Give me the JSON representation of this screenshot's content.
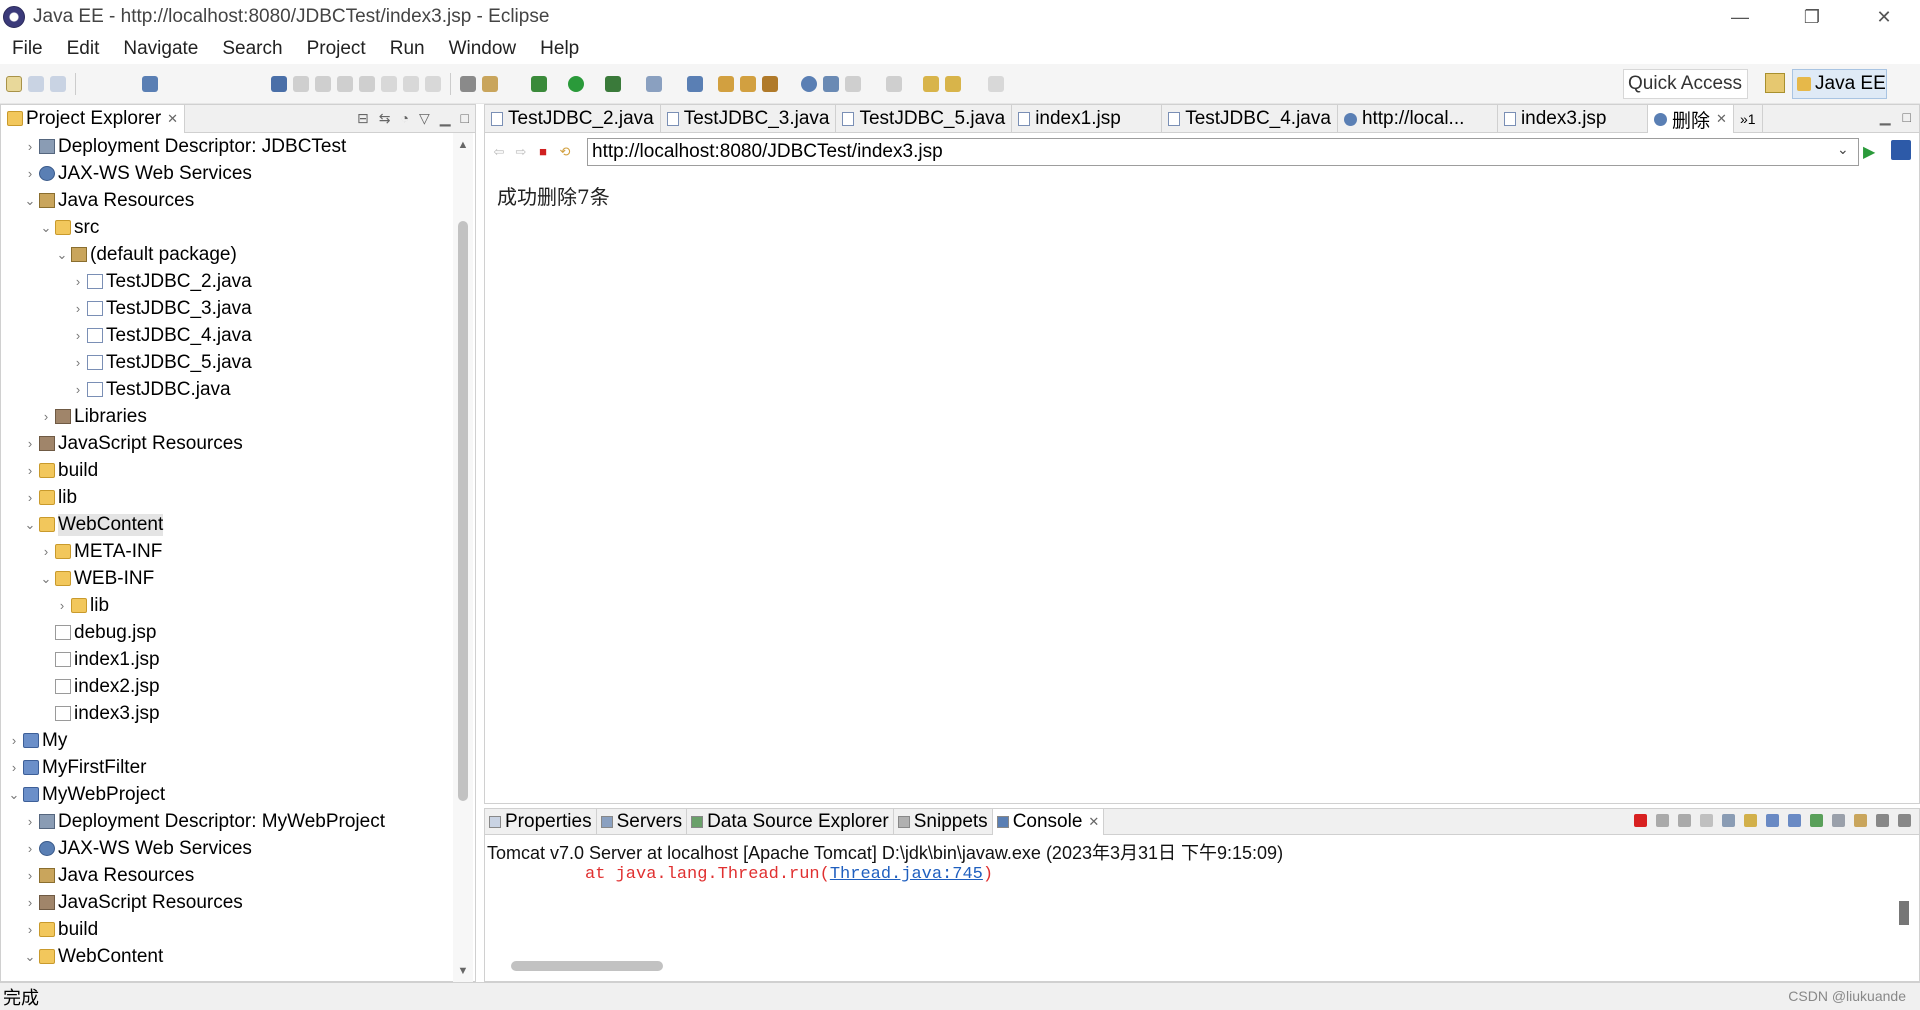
{
  "window": {
    "title": "Java EE - http://localhost:8080/JDBCTest/index3.jsp - Eclipse",
    "minimize": "—",
    "restore": "❐",
    "close": "✕"
  },
  "menu": [
    "File",
    "Edit",
    "Navigate",
    "Search",
    "Project",
    "Run",
    "Window",
    "Help"
  ],
  "toolbar": {
    "quick_access": "Quick Access",
    "perspective": "Java EE"
  },
  "explorer": {
    "title": "Project Explorer",
    "tree": [
      {
        "label": "Deployment Descriptor: JDBCTest",
        "twisty": "›",
        "icon": "dd-icon",
        "indent": 1
      },
      {
        "label": "JAX-WS Web Services",
        "twisty": "›",
        "icon": "ws-icon",
        "indent": 1
      },
      {
        "label": "Java Resources",
        "twisty": "⌄",
        "icon": "java-resources-icon",
        "indent": 1
      },
      {
        "label": "src",
        "twisty": "⌄",
        "icon": "src-folder-icon",
        "indent": 2
      },
      {
        "label": "(default package)",
        "twisty": "⌄",
        "icon": "package-icon",
        "indent": 3
      },
      {
        "label": "TestJDBC_2.java",
        "twisty": "›",
        "icon": "java-file-icon",
        "indent": 4
      },
      {
        "label": "TestJDBC_3.java",
        "twisty": "›",
        "icon": "java-file-icon",
        "indent": 4
      },
      {
        "label": "TestJDBC_4.java",
        "twisty": "›",
        "icon": "java-file-icon",
        "indent": 4
      },
      {
        "label": "TestJDBC_5.java",
        "twisty": "›",
        "icon": "java-file-icon",
        "indent": 4
      },
      {
        "label": "TestJDBC.java",
        "twisty": "›",
        "icon": "java-file-icon",
        "indent": 4
      },
      {
        "label": "Libraries",
        "twisty": "›",
        "icon": "library-icon",
        "indent": 2
      },
      {
        "label": "JavaScript Resources",
        "twisty": "›",
        "icon": "library-icon",
        "indent": 1
      },
      {
        "label": "build",
        "twisty": "›",
        "icon": "folder-icon",
        "indent": 1
      },
      {
        "label": "lib",
        "twisty": "›",
        "icon": "folder-icon",
        "indent": 1
      },
      {
        "label": "WebContent",
        "twisty": "⌄",
        "icon": "folder-icon",
        "indent": 1,
        "selected": true
      },
      {
        "label": "META-INF",
        "twisty": "›",
        "icon": "folder-icon",
        "indent": 2
      },
      {
        "label": "WEB-INF",
        "twisty": "⌄",
        "icon": "folder-icon",
        "indent": 2
      },
      {
        "label": "lib",
        "twisty": "›",
        "icon": "folder-icon",
        "indent": 3
      },
      {
        "label": "debug.jsp",
        "twisty": "",
        "icon": "jsp-file-icon",
        "indent": 2
      },
      {
        "label": "index1.jsp",
        "twisty": "",
        "icon": "jsp-file-icon",
        "indent": 2
      },
      {
        "label": "index2.jsp",
        "twisty": "",
        "icon": "jsp-file-icon",
        "indent": 2
      },
      {
        "label": "index3.jsp",
        "twisty": "",
        "icon": "jsp-file-icon",
        "indent": 2
      },
      {
        "label": "My",
        "twisty": "›",
        "icon": "project-icon",
        "indent": 0
      },
      {
        "label": "MyFirstFilter",
        "twisty": "›",
        "icon": "project-icon",
        "indent": 0
      },
      {
        "label": "MyWebProject",
        "twisty": "⌄",
        "icon": "project-icon",
        "indent": 0
      },
      {
        "label": "Deployment Descriptor: MyWebProject",
        "twisty": "›",
        "icon": "dd-icon",
        "indent": 1
      },
      {
        "label": "JAX-WS Web Services",
        "twisty": "›",
        "icon": "ws-icon",
        "indent": 1
      },
      {
        "label": "Java Resources",
        "twisty": "›",
        "icon": "java-resources-icon",
        "indent": 1
      },
      {
        "label": "JavaScript Resources",
        "twisty": "›",
        "icon": "library-icon",
        "indent": 1
      },
      {
        "label": "build",
        "twisty": "›",
        "icon": "folder-icon",
        "indent": 1
      },
      {
        "label": "WebContent",
        "twisty": "⌄",
        "icon": "folder-icon",
        "indent": 1
      }
    ]
  },
  "editor": {
    "tabs": [
      {
        "label": "TestJDBC_2.java",
        "icon": "java-file-icon"
      },
      {
        "label": "TestJDBC_3.java",
        "icon": "java-file-icon"
      },
      {
        "label": "TestJDBC_5.java",
        "icon": "java-file-icon"
      },
      {
        "label": "index1.jsp",
        "icon": "jsp-file-icon"
      },
      {
        "label": "TestJDBC_4.java",
        "icon": "java-file-icon"
      },
      {
        "label": "http://local...",
        "icon": "globe-icon"
      },
      {
        "label": "index3.jsp",
        "icon": "jsp-file-icon"
      },
      {
        "label": "删除",
        "icon": "globe-icon",
        "active": true
      }
    ],
    "overflow": "»1",
    "url": "http://localhost:8080/JDBCTest/index3.jsp",
    "page_text": "成功删除7条"
  },
  "console": {
    "tabs": [
      {
        "label": "Properties",
        "icon": "properties-icon"
      },
      {
        "label": "Servers",
        "icon": "servers-icon"
      },
      {
        "label": "Data Source Explorer",
        "icon": "datasource-icon"
      },
      {
        "label": "Snippets",
        "icon": "snippets-icon"
      },
      {
        "label": "Console",
        "icon": "console-icon",
        "active": true
      }
    ],
    "header": "Tomcat v7.0 Server at localhost [Apache Tomcat] D:\\jdk\\bin\\javaw.exe (2023年3月31日 下午9:15:09)",
    "line_prefix": "at java.lang.Thread.run(",
    "line_link": "Thread.java:745",
    "line_suffix": ")"
  },
  "status": {
    "text": "完成",
    "watermark": "CSDN @liukuande"
  }
}
